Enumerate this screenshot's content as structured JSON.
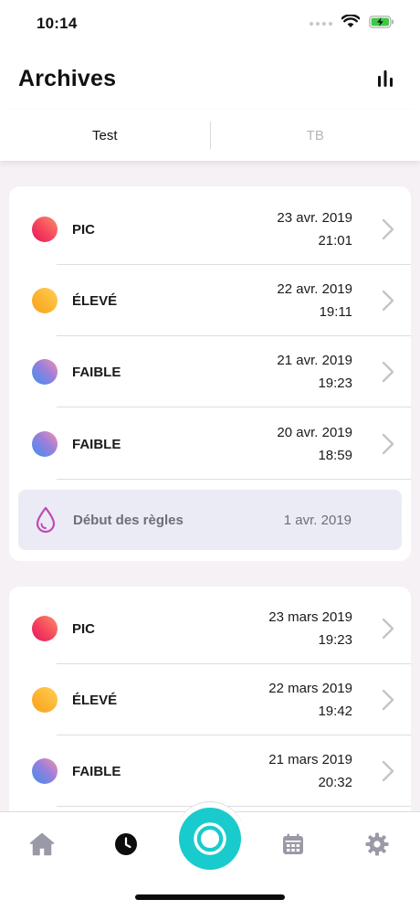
{
  "status_bar": {
    "time": "10:14"
  },
  "header": {
    "title": "Archives"
  },
  "tabs": [
    {
      "label": "Test"
    },
    {
      "label": "TB"
    }
  ],
  "card1": {
    "entries": [
      {
        "level": "PIC",
        "date": "23 avr. 2019",
        "time": "21:01",
        "kind": "pic"
      },
      {
        "level": "ÉLEVÉ",
        "date": "22 avr. 2019",
        "time": "19:11",
        "kind": "eleve"
      },
      {
        "level": "FAIBLE",
        "date": "21 avr. 2019",
        "time": "19:23",
        "kind": "faible"
      },
      {
        "level": "FAIBLE",
        "date": "20 avr. 2019",
        "time": "18:59",
        "kind": "faible"
      }
    ],
    "period": {
      "label": "Début des règles",
      "date": "1 avr. 2019"
    }
  },
  "card2": {
    "entries": [
      {
        "level": "PIC",
        "date": "23 mars 2019",
        "time": "19:23",
        "kind": "pic"
      },
      {
        "level": "ÉLEVÉ",
        "date": "22 mars 2019",
        "time": "19:42",
        "kind": "eleve"
      },
      {
        "level": "FAIBLE",
        "date": "21 mars 2019",
        "time": "20:32",
        "kind": "faible"
      }
    ]
  },
  "tabbar": {
    "items": [
      "home-icon",
      "clock-icon",
      "capture-icon",
      "calendar-icon",
      "gear-icon"
    ],
    "active": "clock-icon"
  },
  "colors": {
    "accent": "#19cbcd",
    "pic": "#e8145a",
    "eleve": "#fcb632",
    "faible": "#6a86e6",
    "period_bg": "#ebebf5",
    "drop": "#c04bb4"
  }
}
